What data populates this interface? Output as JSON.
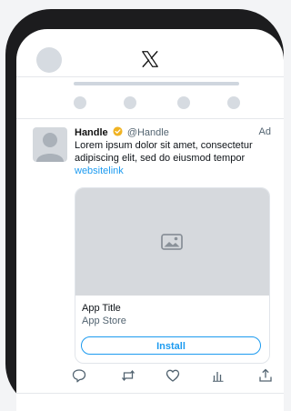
{
  "post": {
    "name": "Handle",
    "handle": "@Handle",
    "ad_label": "Ad",
    "text": "Lorem ipsum dolor sit amet, consectetur adipiscing elit, sed do eiusmod tempor",
    "link": "websitelink"
  },
  "card": {
    "app_title": "App Title",
    "app_store": "App Store",
    "install_label": "Install"
  },
  "icons": {
    "logo": "x-logo-icon",
    "verified": "verified-badge-icon",
    "media": "image-icon",
    "actions": [
      "reply-icon",
      "retweet-icon",
      "like-icon",
      "views-icon",
      "share-icon"
    ]
  },
  "colors": {
    "accent": "#1d9bf0",
    "verified": "#f0b323",
    "placeholder": "#d6d9dd"
  }
}
